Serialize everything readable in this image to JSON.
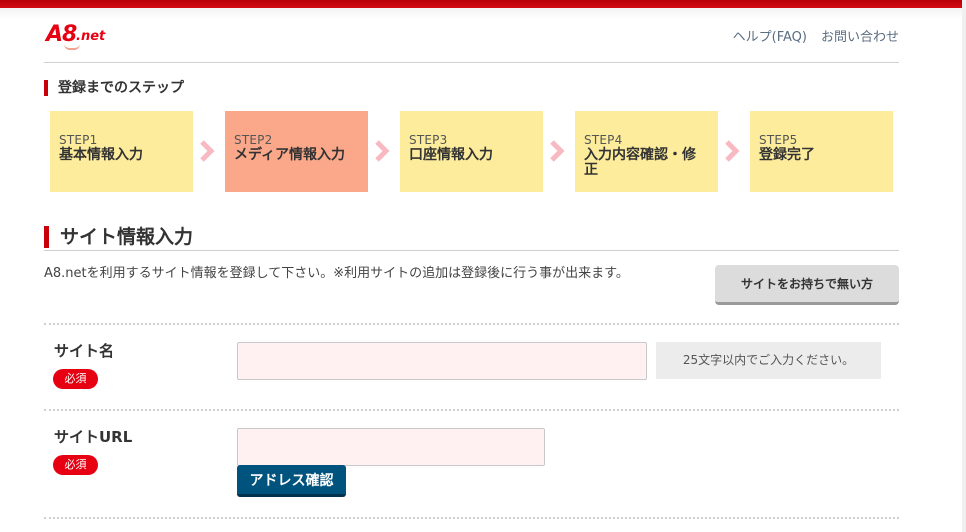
{
  "brand": {
    "logo_main": "A8",
    "logo_suffix": ".net",
    "color": "#e60012"
  },
  "header": {
    "links": [
      {
        "label": "ヘルプ(FAQ)"
      },
      {
        "label": "お問い合わせ"
      }
    ]
  },
  "steps": {
    "heading": "登録までのステップ",
    "items": [
      {
        "number": "STEP1",
        "label": "基本情報入力",
        "active": false
      },
      {
        "number": "STEP2",
        "label": "メディア情報入力",
        "active": true
      },
      {
        "number": "STEP3",
        "label": "口座情報入力",
        "active": false
      },
      {
        "number": "STEP4",
        "label": "入力内容確認・修正",
        "active": false
      },
      {
        "number": "STEP5",
        "label": "登録完了",
        "active": false
      }
    ],
    "colors": {
      "pending": "#fcec9c",
      "active": "#fba88a",
      "arrow": "#f8b9c2"
    }
  },
  "section": {
    "title": "サイト情報入力",
    "intro": "A8.netを利用するサイト情報を登録して下さい。※利用サイトの追加は登録後に行う事が出来ます。",
    "no_site_button": "サイトをお持ちで無い方"
  },
  "form": {
    "site_name": {
      "label": "サイト名",
      "required_badge": "必須",
      "value": "",
      "hint": "25文字以内でご入力ください。"
    },
    "site_url": {
      "label": "サイトURL",
      "required_badge": "必須",
      "value": "",
      "confirm_button": "アドレス確認"
    }
  }
}
